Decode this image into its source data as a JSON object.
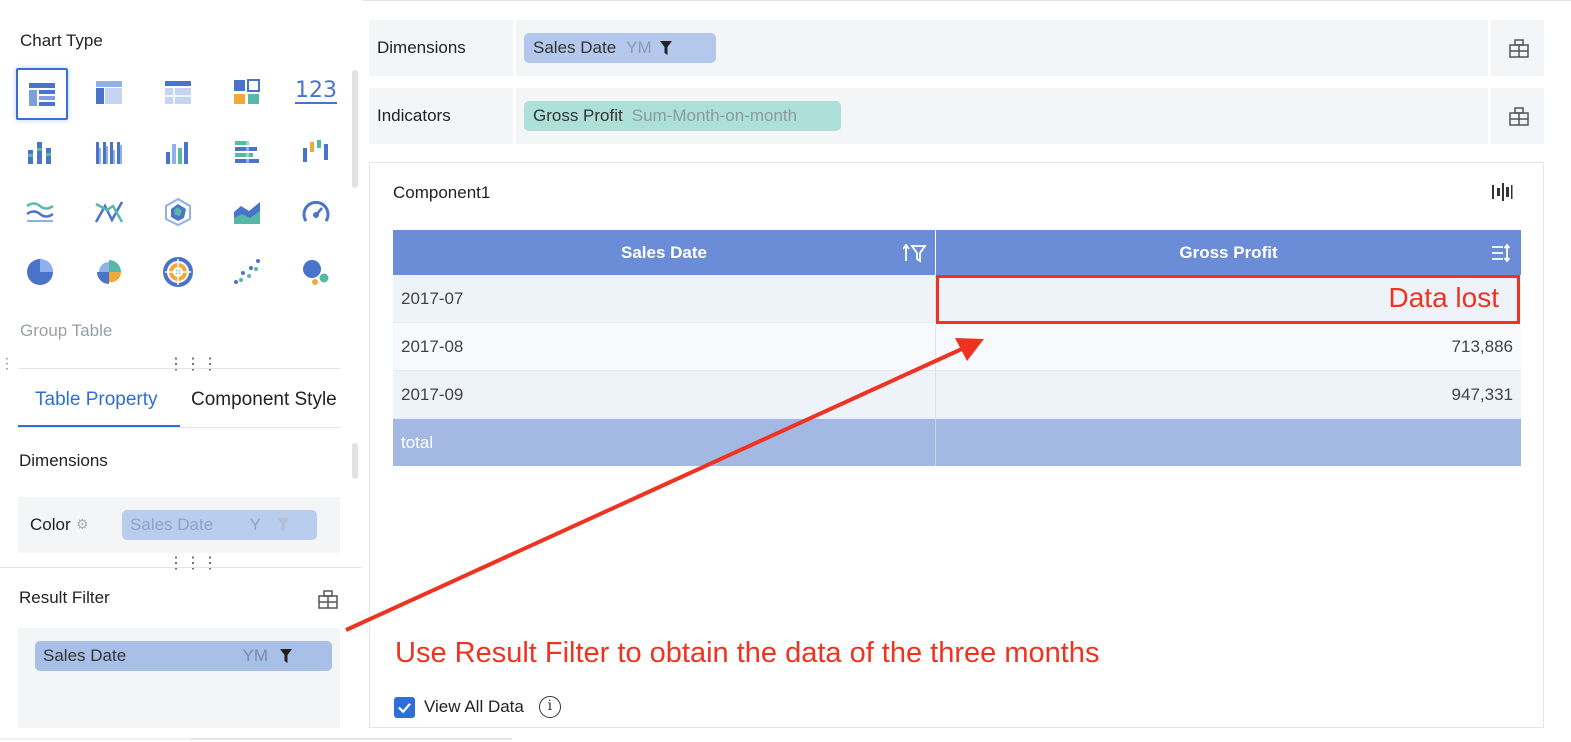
{
  "left_panel": {
    "chart_type_title": "Chart Type",
    "number_icon_text": "123",
    "group_label": "Group Table",
    "tabs": [
      {
        "label": "Table Property",
        "active": true
      },
      {
        "label": "Component Style",
        "active": false
      }
    ],
    "dimensions_title": "Dimensions",
    "color_label": "Color",
    "color_field": {
      "name": "Sales Date",
      "granularity": "Y"
    },
    "result_filter_title": "Result Filter",
    "result_filter_field": {
      "name": "Sales Date",
      "granularity": "YM"
    }
  },
  "dimensions_row": {
    "label": "Dimensions",
    "field": {
      "name": "Sales Date",
      "granularity": "YM"
    }
  },
  "indicators_row": {
    "label": "Indicators",
    "field": {
      "name": "Gross Profit",
      "calc": "Sum-Month-on-month"
    }
  },
  "component": {
    "title": "Component1",
    "table": {
      "headers": [
        "Sales Date",
        "Gross Profit"
      ],
      "rows": [
        {
          "date": "2017-07",
          "value": ""
        },
        {
          "date": "2017-08",
          "value": "713,886"
        },
        {
          "date": "2017-09",
          "value": "947,331"
        }
      ],
      "total_label": "total",
      "total_value": ""
    },
    "view_all_label": "View All Data",
    "view_all_checked": true
  },
  "annotations": {
    "data_lost": "Data lost",
    "note": "Use Result Filter to obtain the data of the three months",
    "color": "#ee3322"
  },
  "colors": {
    "accent": "#2d6fd6",
    "table_header": "#6b8cd6",
    "total_row": "#a3b9e4",
    "dimension_pill": "#b3c8ec",
    "indicator_pill": "#ade0d8"
  }
}
